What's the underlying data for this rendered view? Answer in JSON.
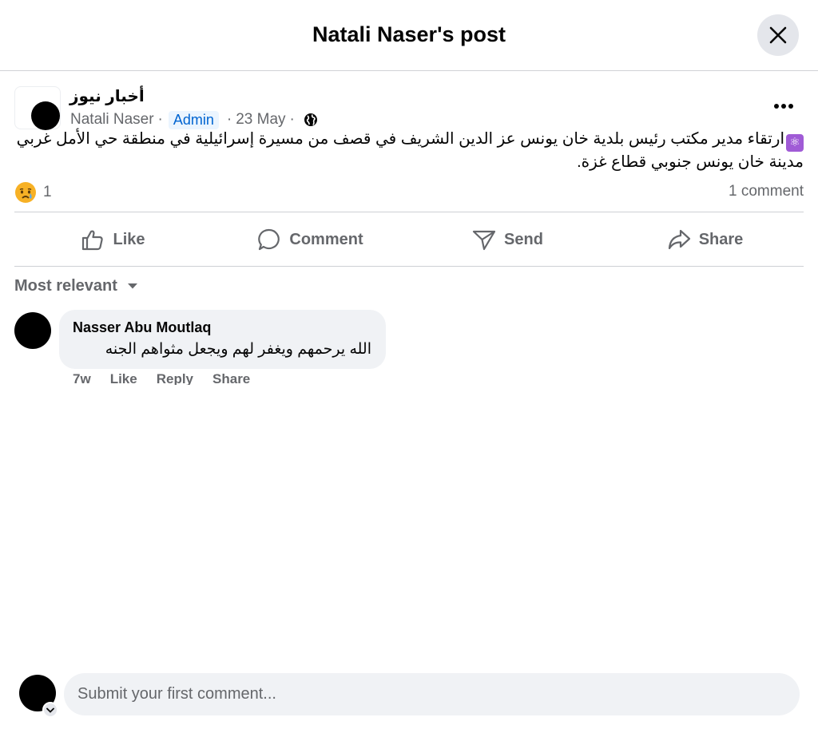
{
  "dialog": {
    "title": "Natali Naser's post"
  },
  "post": {
    "page_name": "أخبار نيوز",
    "author": "Natali Naser",
    "role_badge": "Admin",
    "date": "23 May",
    "text": "ارتقاء مدير مكتب رئيس بلدية خان يونس عز الدين الشريف في قصف من مسيرة إسرائيلية في منطقة حي الأمل غربي مدينة خان يونس جنوبي قطاع غزة.",
    "emoji_icon": "atom-emoji-icon",
    "reaction_emoji": "sad-crying-emoji",
    "reaction_count": "1",
    "comment_count": "1 comment"
  },
  "actions": {
    "like": "Like",
    "comment": "Comment",
    "send": "Send",
    "share": "Share"
  },
  "comments": {
    "sort_label": "Most relevant",
    "items": [
      {
        "author": "Nasser Abu Moutlaq",
        "text": "الله يرحمهم ويغفر لهم ويجعل مثواهم الجنه",
        "time": "7w",
        "like": "Like",
        "reply": "Reply",
        "share": "Share"
      }
    ]
  },
  "composer": {
    "placeholder": "Submit your first comment..."
  },
  "colors": {
    "secondary_text": "#65676b",
    "badge_blue": "#0064d1",
    "bubble_bg": "#f0f2f5"
  }
}
